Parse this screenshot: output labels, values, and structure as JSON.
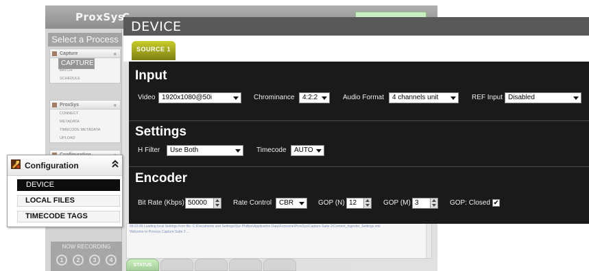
{
  "background_app": {
    "logo": "ProxSys",
    "logo_tail": "C",
    "select_process": "Select a Process",
    "panels": [
      {
        "title": "Capture",
        "items": [
          "CAPTURE",
          "PLAYBACK",
          "BATCH",
          "SCHEDULE"
        ],
        "selected": "CAPTURE"
      },
      {
        "title": "ProxSys",
        "items": [
          "CONNECT",
          "METADATA",
          "TIMECODE METADATA",
          "UPLOAD"
        ]
      },
      {
        "title": "Configuration",
        "items": []
      }
    ],
    "now_recording": "NOW RECORDING",
    "recording_slots": [
      "1",
      "2",
      "3",
      "4"
    ],
    "log_lines": [
      "09:22:29 Loading local Settings from file: C:\\Documents and Settings\\Sys Phillips\\Application Data\\Forscene\\ProxSys\\Capture Suite 2\\Content_Ingester_Settings.xml",
      "Welcome to Proxsys Capture Suite 2 ..."
    ],
    "bottom_tabs": [
      "STATUS",
      "",
      "",
      "",
      ""
    ]
  },
  "device": {
    "title": "DEVICE",
    "source_tab": "SOURCE 1",
    "input": {
      "heading": "Input",
      "video_label": "Video",
      "video_value": "1920x1080@50i",
      "chroma_label": "Chrominance",
      "chroma_value": "4:2:2",
      "audio_label": "Audio Format",
      "audio_value": "4 channels unit",
      "ref_label": "REF Input",
      "ref_value": "Disabled"
    },
    "settings": {
      "heading": "Settings",
      "hfilter_label": "H Filter",
      "hfilter_value": "Use Both",
      "timecode_label": "Timecode",
      "timecode_value": "AUTO"
    },
    "encoder": {
      "heading": "Encoder",
      "bitrate_label": "Bit Rate (Kbps)",
      "bitrate_value": "50000",
      "ratecontrol_label": "Rate Control",
      "ratecontrol_value": "CBR",
      "gopn_label": "GOP (N)",
      "gopn_value": "12",
      "gopm_label": "GOP (M)",
      "gopm_value": "3",
      "gopclosed_label": "GOP: Closed",
      "gopclosed_checked": "✔"
    }
  },
  "config_panel": {
    "title": "Configuration",
    "collapse_glyph": "»",
    "items": [
      "DEVICE",
      "LOCAL FILES",
      "TIMECODE TAGS"
    ],
    "active_item": "DEVICE"
  },
  "colors": {
    "source_tab": "#a4a81c",
    "status_tab": "#8ac17c",
    "section_bg": "#1a1a1a",
    "title_bar": "#595959"
  }
}
